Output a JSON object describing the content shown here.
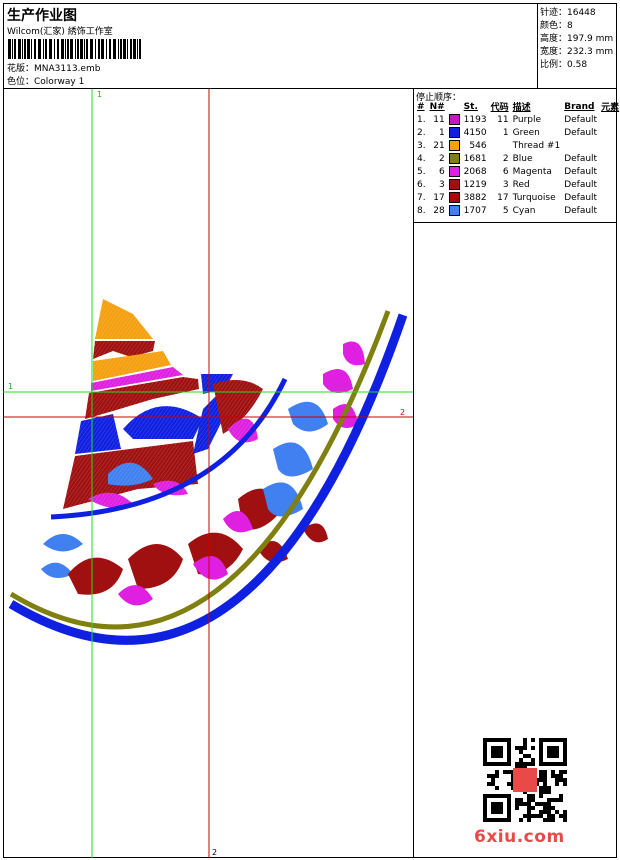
{
  "header": {
    "title": "生产作业图",
    "company": "Wilcom(汇家) 綉饰工作室",
    "design_label": "花版：",
    "design_value": "MNA3113.emb",
    "colorway_label": "色位：",
    "colorway_value": "Colorway 1"
  },
  "stats": {
    "stitches": "针迹：16448",
    "colors": "颜色：8",
    "height": "高度：197.9 mm",
    "width": "宽度：232.3 mm",
    "scale": "比例：0.58"
  },
  "stops": {
    "title": "停止顺序：",
    "headers": [
      "#",
      "N#",
      "St.",
      "代码",
      "描述",
      "Brand",
      "元素"
    ],
    "rows": [
      {
        "idx": "1.",
        "n": "11",
        "color": "#cc11cc",
        "st": "1193",
        "code": "11",
        "desc": "Purple",
        "brand": "Default"
      },
      {
        "idx": "2.",
        "n": "1",
        "color": "#1020e0",
        "st": "4150",
        "code": "1",
        "desc": "Green",
        "brand": "Default"
      },
      {
        "idx": "3.",
        "n": "21",
        "color": "#f5a010",
        "st": "546",
        "code": "",
        "desc": "Thread #1",
        "brand": ""
      },
      {
        "idx": "4.",
        "n": "2",
        "color": "#808010",
        "st": "1681",
        "code": "2",
        "desc": "Blue",
        "brand": "Default"
      },
      {
        "idx": "5.",
        "n": "6",
        "color": "#e020e0",
        "st": "2068",
        "code": "6",
        "desc": "Magenta",
        "brand": "Default"
      },
      {
        "idx": "6.",
        "n": "3",
        "color": "#a01010",
        "st": "1219",
        "code": "3",
        "desc": "Red",
        "brand": "Default"
      },
      {
        "idx": "7.",
        "n": "17",
        "color": "#a80808",
        "st": "3882",
        "code": "17",
        "desc": "Turquoise",
        "brand": "Default"
      },
      {
        "idx": "8.",
        "n": "28",
        "color": "#4080f0",
        "st": "1707",
        "code": "5",
        "desc": "Cyan",
        "brand": "Default"
      }
    ]
  },
  "guides": {
    "green_v_top": "1",
    "green_h_left": "1",
    "red_h_right": "2",
    "red_v_bottom": "2"
  },
  "colors": {
    "guide_green": "#22dd22",
    "guide_red": "#cc0000",
    "purple": "#cc11cc",
    "blue": "#1020e0",
    "orange": "#f5a010",
    "olive": "#808010",
    "magenta": "#e020e0",
    "red": "#a01010",
    "cyan": "#4080f0"
  },
  "footer": {
    "brand": "6xiu.com"
  }
}
